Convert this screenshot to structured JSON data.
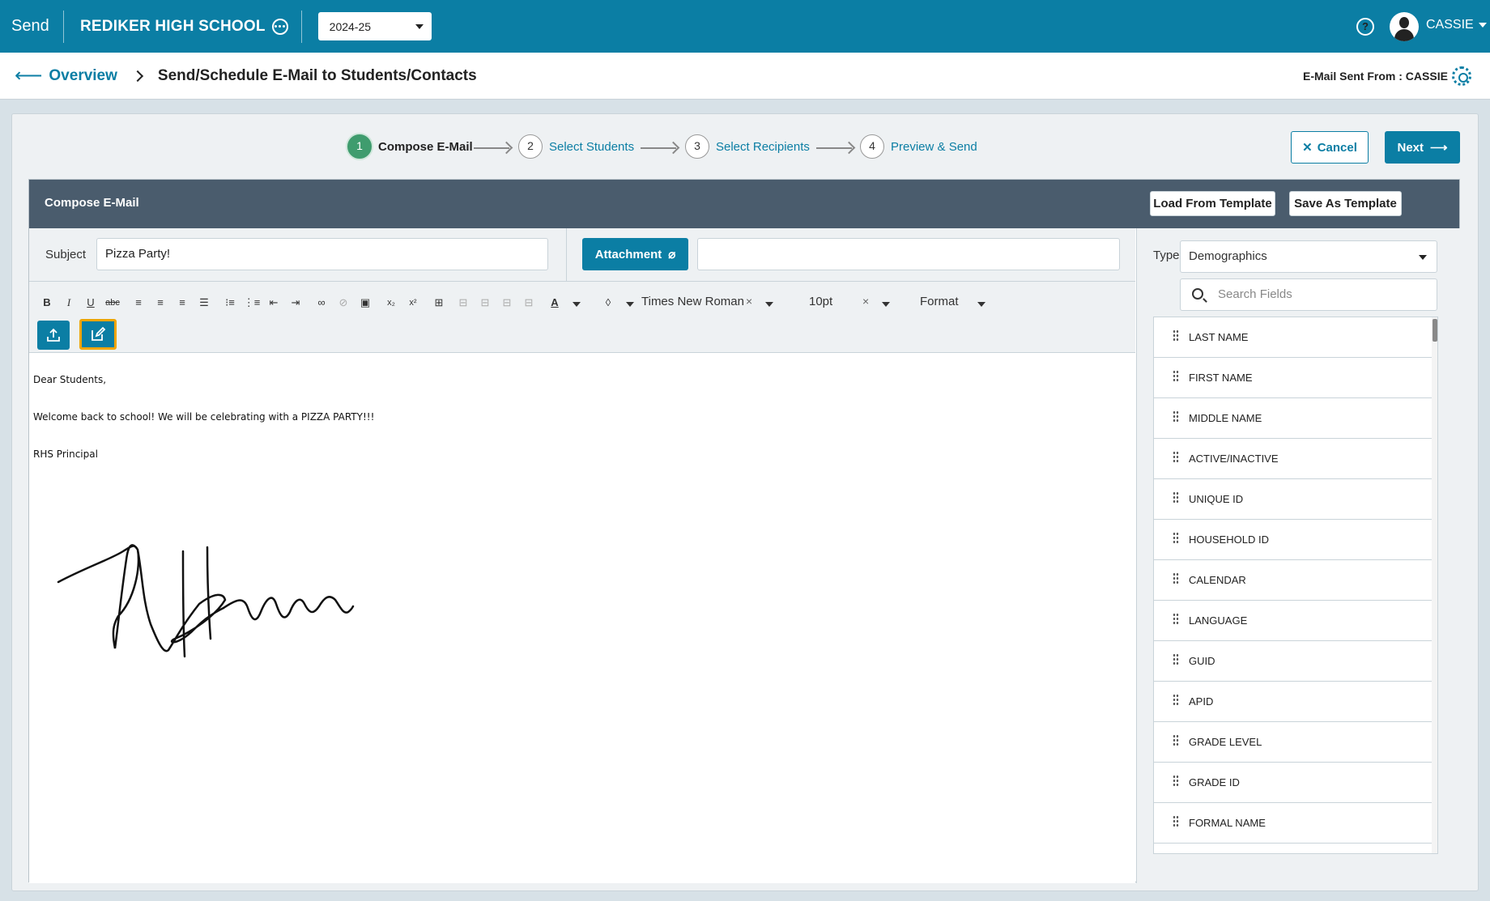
{
  "topbar": {
    "app_label": "Send",
    "school_name": "REDIKER HIGH SCHOOL",
    "year": "2024-25",
    "help_icon": "?",
    "user": "CASSIE"
  },
  "header": {
    "back_label": "Overview",
    "title": "Send/Schedule E-Mail to Students/Contacts",
    "sent_from_label": "E-Mail Sent From :",
    "sent_from_user": "CASSIE"
  },
  "steps": [
    {
      "num": "1",
      "label": "Compose E-Mail",
      "active": true
    },
    {
      "num": "2",
      "label": "Select Students",
      "active": false
    },
    {
      "num": "3",
      "label": "Select Recipients",
      "active": false
    },
    {
      "num": "4",
      "label": "Preview & Send",
      "active": false
    }
  ],
  "actions": {
    "cancel": "Cancel",
    "next": "Next"
  },
  "compose": {
    "title": "Compose E-Mail",
    "load_template": "Load From Template",
    "save_template": "Save As Template",
    "subject_label": "Subject",
    "subject_value": "Pizza Party!",
    "attachment_label": "Attachment",
    "attachment_value": ""
  },
  "toolbar": {
    "font_family": "Times New Roman",
    "font_size": "10pt",
    "format": "Format",
    "clear": "×"
  },
  "editor": {
    "greeting": "Dear Students,",
    "body": "Welcome back to school! We will be celebrating with a PIZZA PARTY!!!",
    "sign_off": "RHS Principal"
  },
  "fields_panel": {
    "type_label": "Type",
    "type_value": "Demographics",
    "search_placeholder": "Search Fields",
    "items": [
      "LAST NAME",
      "FIRST NAME",
      "MIDDLE NAME",
      "ACTIVE/INACTIVE",
      "UNIQUE ID",
      "HOUSEHOLD ID",
      "CALENDAR",
      "LANGUAGE",
      "GUID",
      "APID",
      "GRADE LEVEL",
      "GRADE ID",
      "FORMAL NAME"
    ]
  },
  "colors": {
    "brand": "#0b7ea4",
    "panel_header": "#4a5c6d",
    "active_step": "#3f9c6e",
    "highlight": "#f0a500"
  }
}
